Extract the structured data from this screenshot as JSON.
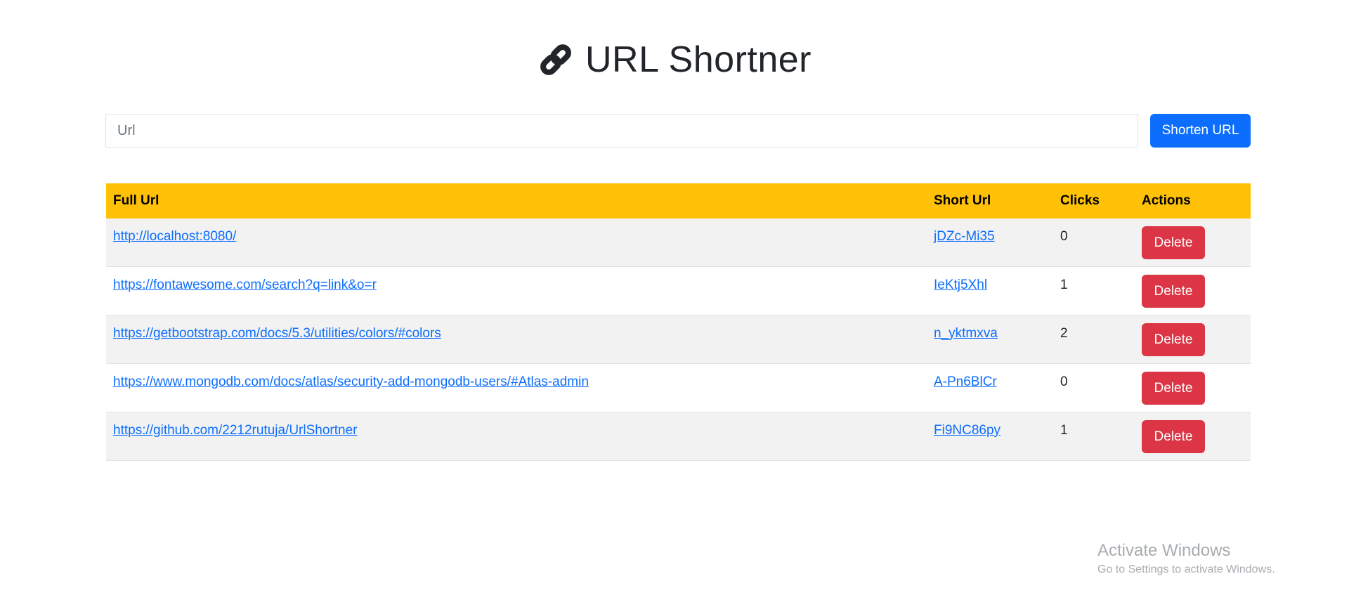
{
  "header": {
    "title": "URL Shortner",
    "icon": "link-icon"
  },
  "form": {
    "input_placeholder": "Url",
    "input_value": "",
    "submit_label": "Shorten URL"
  },
  "table": {
    "columns": [
      "Full Url",
      "Short Url",
      "Clicks",
      "Actions"
    ],
    "rows": [
      {
        "full": "http://localhost:8080/",
        "short": "jDZc-Mi35",
        "clicks": "0",
        "action": "Delete"
      },
      {
        "full": "https://fontawesome.com/search?q=link&o=r",
        "short": "IeKtj5Xhl",
        "clicks": "1",
        "action": "Delete"
      },
      {
        "full": "https://getbootstrap.com/docs/5.3/utilities/colors/#colors",
        "short": "n_yktmxva",
        "clicks": "2",
        "action": "Delete"
      },
      {
        "full": "https://www.mongodb.com/docs/atlas/security-add-mongodb-users/#Atlas-admin",
        "short": "A-Pn6BlCr",
        "clicks": "0",
        "action": "Delete"
      },
      {
        "full": "https://github.com/2212rutuja/UrlShortner",
        "short": "Fi9NC86py",
        "clicks": "1",
        "action": "Delete"
      }
    ]
  },
  "watermark": {
    "title": "Activate Windows",
    "subtitle": "Go to Settings to activate Windows."
  },
  "colors": {
    "header_bg": "#ffc107",
    "primary": "#0d6efd",
    "danger": "#dc3545",
    "stripe": "#f2f2f2"
  }
}
